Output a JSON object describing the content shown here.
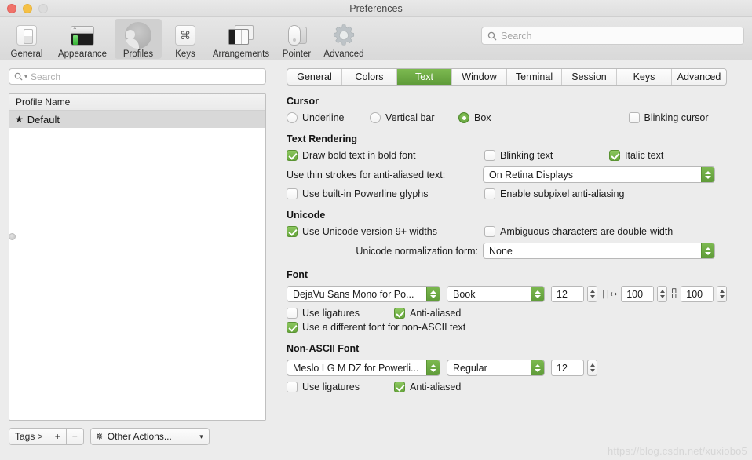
{
  "window": {
    "title": "Preferences",
    "traffic_lights": [
      "close-button",
      "minimize-button",
      "zoom-button"
    ]
  },
  "toolbar": {
    "items": [
      {
        "label": "General",
        "icon": "general-icon",
        "selected": false
      },
      {
        "label": "Appearance",
        "icon": "appearance-icon",
        "selected": false
      },
      {
        "label": "Profiles",
        "icon": "profiles-icon",
        "selected": true
      },
      {
        "label": "Keys",
        "icon": "keys-icon",
        "selected": false
      },
      {
        "label": "Arrangements",
        "icon": "arrangements-icon",
        "selected": false
      },
      {
        "label": "Pointer",
        "icon": "pointer-icon",
        "selected": false
      },
      {
        "label": "Advanced",
        "icon": "advanced-gear-icon",
        "selected": false
      }
    ],
    "search": {
      "placeholder": "Search",
      "value": "",
      "icon": "search-icon"
    }
  },
  "sidebar": {
    "search": {
      "placeholder": "Search",
      "value": "",
      "icon": "search-icon"
    },
    "list": {
      "column_header": "Profile Name",
      "rows": [
        {
          "name": "Default",
          "default_marker": "★",
          "selected": true
        }
      ]
    },
    "footer": {
      "tags_label": "Tags >",
      "add_label": "+",
      "remove_label": "−",
      "other_actions_label": "Other Actions...",
      "other_actions_icon": "gear-icon",
      "chevron_icon": "chevron-down-icon"
    }
  },
  "main": {
    "tabs": [
      {
        "label": "General",
        "active": false
      },
      {
        "label": "Colors",
        "active": false
      },
      {
        "label": "Text",
        "active": true
      },
      {
        "label": "Window",
        "active": false
      },
      {
        "label": "Terminal",
        "active": false
      },
      {
        "label": "Session",
        "active": false
      },
      {
        "label": "Keys",
        "active": false
      },
      {
        "label": "Advanced",
        "active": false
      }
    ],
    "cursor": {
      "title": "Cursor",
      "options": [
        {
          "label": "Underline",
          "selected": false
        },
        {
          "label": "Vertical bar",
          "selected": false
        },
        {
          "label": "Box",
          "selected": true
        }
      ],
      "blinking_cursor": {
        "label": "Blinking cursor",
        "checked": false
      }
    },
    "text_rendering": {
      "title": "Text Rendering",
      "draw_bold": {
        "label": "Draw bold text in bold font",
        "checked": true
      },
      "blinking_text": {
        "label": "Blinking text",
        "checked": false
      },
      "italic_text": {
        "label": "Italic text",
        "checked": true
      },
      "thin_strokes": {
        "label": "Use thin strokes for anti-aliased text:",
        "value": "On Retina Displays"
      },
      "powerline": {
        "label": "Use built-in Powerline glyphs",
        "checked": false
      },
      "subpixel": {
        "label": "Enable subpixel anti-aliasing",
        "checked": false
      }
    },
    "unicode": {
      "title": "Unicode",
      "version9": {
        "label": "Use Unicode version 9+ widths",
        "checked": true
      },
      "ambiguous": {
        "label": "Ambiguous characters are double-width",
        "checked": false
      },
      "normalization": {
        "label": "Unicode normalization form:",
        "value": "None"
      }
    },
    "font": {
      "title": "Font",
      "family": "DejaVu Sans Mono for Po...",
      "style": "Book",
      "size": "12",
      "horizontal_spacing": "100",
      "vertical_spacing": "100",
      "horizontal_icon": "horizontal-spacing-icon",
      "vertical_icon": "vertical-spacing-icon",
      "ligatures": {
        "label": "Use ligatures",
        "checked": false
      },
      "antialiased": {
        "label": "Anti-aliased",
        "checked": true
      },
      "different_font": {
        "label": "Use a different font for non-ASCII text",
        "checked": true
      }
    },
    "non_ascii_font": {
      "title": "Non-ASCII Font",
      "family": "Meslo LG M DZ for Powerli...",
      "style": "Regular",
      "size": "12",
      "ligatures": {
        "label": "Use ligatures",
        "checked": false
      },
      "antialiased": {
        "label": "Anti-aliased",
        "checked": true
      }
    }
  },
  "watermark": "https://blog.csdn.net/xuxiobo5",
  "colors": {
    "accent_green": "#6aa83d",
    "window_bg": "#ececec",
    "selection_gray": "#d8d8d8"
  }
}
